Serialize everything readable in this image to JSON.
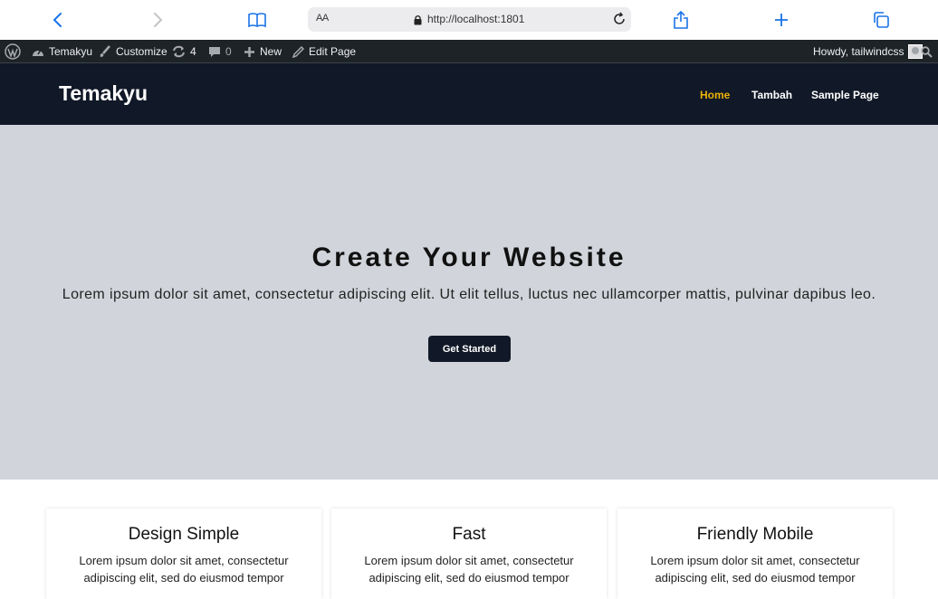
{
  "browser": {
    "text_size_label": "AA",
    "url": "http://localhost:1801"
  },
  "admin_bar": {
    "site_name": "Temakyu",
    "customize": "Customize",
    "updates_count": "4",
    "comments_count": "0",
    "new_label": "New",
    "edit_page": "Edit Page",
    "howdy": "Howdy, tailwindcss"
  },
  "header": {
    "logo": "Temakyu",
    "nav": [
      {
        "label": "Home",
        "active": true
      },
      {
        "label": "Tambah",
        "active": false
      },
      {
        "label": "Sample Page",
        "active": false
      }
    ]
  },
  "hero": {
    "title": "Create Your Website",
    "text": "Lorem ipsum dolor sit amet, consectetur adipiscing elit. Ut elit tellus, luctus nec ullamcorper mattis, pulvinar dapibus leo.",
    "button": "Get Started"
  },
  "features": [
    {
      "title": "Design Simple",
      "text": "Lorem ipsum dolor sit amet, consectetur adipiscing elit, sed do eiusmod tempor"
    },
    {
      "title": "Fast",
      "text": "Lorem ipsum dolor sit amet, consectetur adipiscing elit, sed do eiusmod tempor"
    },
    {
      "title": "Friendly Mobile",
      "text": "Lorem ipsum dolor sit amet, consectetur adipiscing elit, sed do eiusmod tempor"
    }
  ],
  "colors": {
    "accent": "#eab308",
    "header_bg": "#111827",
    "hero_bg": "#d1d5db",
    "browser_blue": "#1a73e8"
  }
}
